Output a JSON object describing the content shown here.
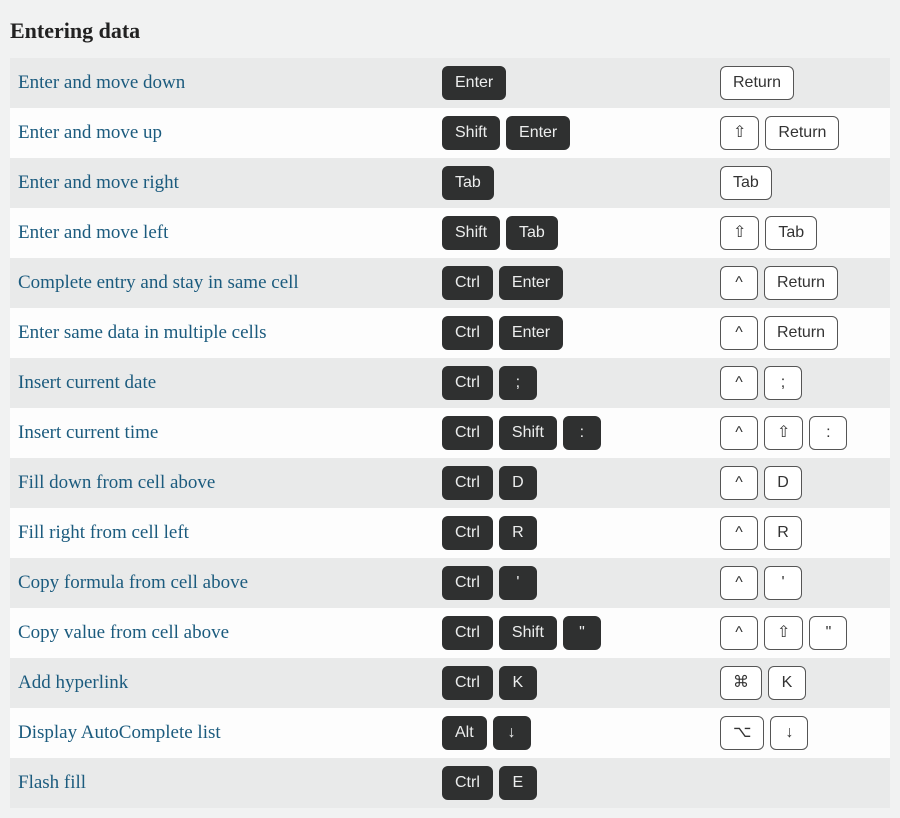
{
  "section_title": "Entering data",
  "shortcuts": [
    {
      "desc": "Enter and move down",
      "win": [
        "Enter"
      ],
      "mac": [
        "Return"
      ]
    },
    {
      "desc": "Enter and move up",
      "win": [
        "Shift",
        "Enter"
      ],
      "mac": [
        "⇧",
        "Return"
      ]
    },
    {
      "desc": "Enter and move right",
      "win": [
        "Tab"
      ],
      "mac": [
        "Tab"
      ]
    },
    {
      "desc": "Enter and move left",
      "win": [
        "Shift",
        "Tab"
      ],
      "mac": [
        "⇧",
        "Tab"
      ]
    },
    {
      "desc": "Complete entry and stay in same cell",
      "win": [
        "Ctrl",
        "Enter"
      ],
      "mac": [
        "^",
        "Return"
      ]
    },
    {
      "desc": "Enter same data in multiple cells",
      "win": [
        "Ctrl",
        "Enter"
      ],
      "mac": [
        "^",
        "Return"
      ]
    },
    {
      "desc": "Insert current date",
      "win": [
        "Ctrl",
        ";"
      ],
      "mac": [
        "^",
        ";"
      ]
    },
    {
      "desc": "Insert current time",
      "win": [
        "Ctrl",
        "Shift",
        ":"
      ],
      "mac": [
        "^",
        "⇧",
        ":"
      ]
    },
    {
      "desc": "Fill down from cell above",
      "win": [
        "Ctrl",
        "D"
      ],
      "mac": [
        "^",
        "D"
      ]
    },
    {
      "desc": "Fill right from cell left",
      "win": [
        "Ctrl",
        "R"
      ],
      "mac": [
        "^",
        "R"
      ]
    },
    {
      "desc": "Copy formula from cell above",
      "win": [
        "Ctrl",
        "'"
      ],
      "mac": [
        "^",
        "'"
      ]
    },
    {
      "desc": "Copy value from cell above",
      "win": [
        "Ctrl",
        "Shift",
        "\""
      ],
      "mac": [
        "^",
        "⇧",
        "\""
      ]
    },
    {
      "desc": "Add hyperlink",
      "win": [
        "Ctrl",
        "K"
      ],
      "mac": [
        "⌘",
        "K"
      ]
    },
    {
      "desc": "Display AutoComplete list",
      "win": [
        "Alt",
        "↓"
      ],
      "mac": [
        "⌥",
        "↓"
      ]
    },
    {
      "desc": "Flash fill",
      "win": [
        "Ctrl",
        "E"
      ],
      "mac": []
    }
  ]
}
